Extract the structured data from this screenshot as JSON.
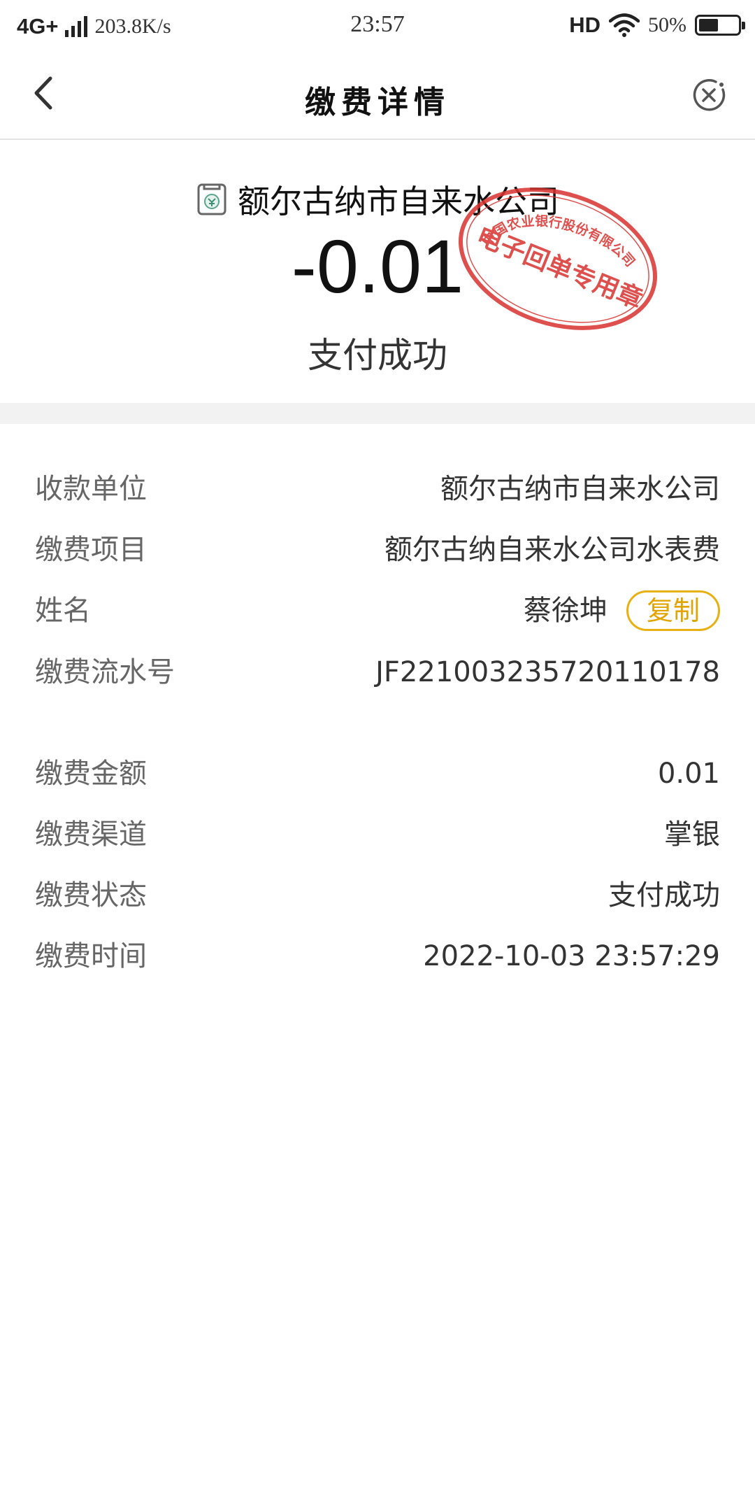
{
  "status_bar": {
    "network": "4G+",
    "speed": "203.8K/s",
    "time": "23:57",
    "hd": "HD",
    "battery_percent": "50%",
    "battery_level": 0.5
  },
  "nav": {
    "title": "缴费详情",
    "back_icon": "chevron-left-icon",
    "close_icon": "close-circle-icon"
  },
  "hero": {
    "company": "额尔古纳市自来水公司",
    "company_icon": "bill-receipt-icon",
    "amount": "-0.01",
    "status": "支付成功",
    "stamp": {
      "top_text": "中国农业银行股份有限公司",
      "main_text": "电子回单专用章",
      "color": "#d8322e"
    }
  },
  "details": [
    {
      "label": "收款单位",
      "value": "额尔古纳市自来水公司"
    },
    {
      "label": "缴费项目",
      "value": "额尔古纳自来水公司水表费"
    },
    {
      "label": "姓名",
      "value": "蔡徐坤",
      "action": "复制"
    },
    {
      "label": "缴费流水号",
      "value": "JF221003235720110178"
    },
    {
      "label": "缴费金额",
      "value": "0.01"
    },
    {
      "label": "缴费渠道",
      "value": "掌银"
    },
    {
      "label": "缴费状态",
      "value": "支付成功"
    },
    {
      "label": "缴费时间",
      "value": "2022-10-03 23:57:29"
    }
  ],
  "colors": {
    "accent": "#e1a400",
    "stamp_red": "#d8322e",
    "band": "#f2f2f2"
  }
}
